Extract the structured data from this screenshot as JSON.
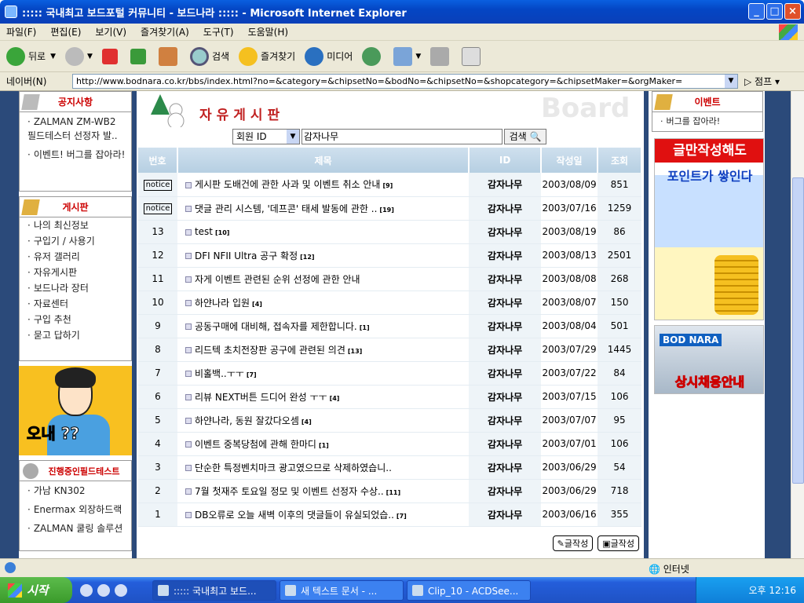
{
  "window": {
    "title": "::::: 국내최고 보드포털 커뮤니티 - 보드나라 ::::: - Microsoft Internet Explorer"
  },
  "menu": [
    "파일(F)",
    "편집(E)",
    "보기(V)",
    "즐겨찾기(A)",
    "도구(T)",
    "도움말(H)"
  ],
  "toolbar": {
    "back": "뒤로",
    "search": "검색",
    "favorites": "즐겨찾기",
    "media": "미디어"
  },
  "address": {
    "label": "네이버(N)",
    "url": "http://www.bodnara.co.kr/bbs/index.html?no=&category=&chipsetNo=&bodNo=&chipsetNo=&shopcategory=&chipsetMaker=&orgMaker=",
    "go": "점프"
  },
  "left": {
    "notice_title": "공지사항",
    "notice_items": [
      "ZALMAN ZM-WB2 필드테스터 선정자 발..",
      "이벤트! 버그를 잡아라!"
    ],
    "board_title": "게시판",
    "board_items": [
      "나의 최신정보",
      "구입기 / 사용기",
      "유저 갤러리",
      "자유게시판",
      "보드나라 장터",
      "자료센터",
      "구입 추천",
      "묻고 답하기"
    ],
    "cartoon_text": "오내 ??",
    "field_title": "진행중인필드테스트",
    "field_items": [
      "가남 KN302",
      "Enermax 외장하드랙",
      "ZALMAN 쿨링 솔루션"
    ]
  },
  "board": {
    "title": "자유게시판",
    "bg_word": "Board",
    "search_select": "회원 ID",
    "search_value": "감자나무",
    "search_button": "검색",
    "headers": [
      "번호",
      "제목",
      "ID",
      "작성일",
      "조회"
    ],
    "rows": [
      {
        "no": "notice",
        "subject": "게시판 도배건에 관한 사과 및 이벤트 취소 안내",
        "count": "[9]",
        "id": "감자나무",
        "date": "2003/08/09",
        "views": "851"
      },
      {
        "no": "notice",
        "subject": "댓글 관리 시스템, '데프콘' 태세 발동에 관한 ..",
        "count": "[19]",
        "id": "감자나무",
        "date": "2003/07/16",
        "views": "1259"
      },
      {
        "no": "13",
        "subject": "test",
        "count": "[10]",
        "id": "감자나무",
        "date": "2003/08/19",
        "views": "86"
      },
      {
        "no": "12",
        "subject": "DFI NFII Ultra 공구 확정",
        "count": "[12]",
        "id": "감자나무",
        "date": "2003/08/13",
        "views": "2501"
      },
      {
        "no": "11",
        "subject": "자게 이벤트 관련된 순위 선정에 관한 안내",
        "count": "",
        "id": "감자나무",
        "date": "2003/08/08",
        "views": "268"
      },
      {
        "no": "10",
        "subject": "하얀나라 입원",
        "count": "[4]",
        "id": "감자나무",
        "date": "2003/08/07",
        "views": "150"
      },
      {
        "no": "9",
        "subject": "공동구매에 대비해, 접속자를 제한합니다.",
        "count": "[1]",
        "id": "감자나무",
        "date": "2003/08/04",
        "views": "501"
      },
      {
        "no": "8",
        "subject": "리드텍 초치전장판 공구에 관련된 의견",
        "count": "[13]",
        "id": "감자나무",
        "date": "2003/07/29",
        "views": "1445"
      },
      {
        "no": "7",
        "subject": "비홀백..ㅜㅜ",
        "count": "[7]",
        "id": "감자나무",
        "date": "2003/07/22",
        "views": "84"
      },
      {
        "no": "6",
        "subject": "리뷰 NEXT버튼 드디어 완성 ㅜㅜ",
        "count": "[4]",
        "id": "감자나무",
        "date": "2003/07/15",
        "views": "106"
      },
      {
        "no": "5",
        "subject": "하얀나라, 동원 잘갔다오셈",
        "count": "[4]",
        "id": "감자나무",
        "date": "2003/07/07",
        "views": "95"
      },
      {
        "no": "4",
        "subject": "이벤트 중복당첨에 관해 한마디",
        "count": "[1]",
        "id": "감자나무",
        "date": "2003/07/01",
        "views": "106"
      },
      {
        "no": "3",
        "subject": "단순한 특정벤치마크 광고였으므로 삭제하였습니..",
        "count": "",
        "id": "감자나무",
        "date": "2003/06/29",
        "views": "54"
      },
      {
        "no": "2",
        "subject": "7월 첫재주 토요일 정모 및 이벤트 선정자 수상..",
        "count": "[11]",
        "id": "감자나무",
        "date": "2003/06/29",
        "views": "718"
      },
      {
        "no": "1",
        "subject": "DB오류로 오늘 새벽 이후의 댓글들이 유실되었습..",
        "count": "[7]",
        "id": "감자나무",
        "date": "2003/06/16",
        "views": "355"
      }
    ],
    "write1": "글작성",
    "write2": "글작성"
  },
  "right": {
    "event_title": "이벤트",
    "event_item": "버그를 잡아라!",
    "ad1_line1": "글만작성해도",
    "ad1_line2": "포인트가 쌓인다",
    "ad2_logo": "BOD NARA",
    "ad2_text": "상시채용안내"
  },
  "status": {
    "zone": "인터넷"
  },
  "taskbar": {
    "start": "시작",
    "tasks": [
      "::::: 국내최고 보드...",
      "새 텍스트 문서 - ...",
      "Clip_10 - ACDSee..."
    ],
    "clock": "오후 12:16"
  }
}
